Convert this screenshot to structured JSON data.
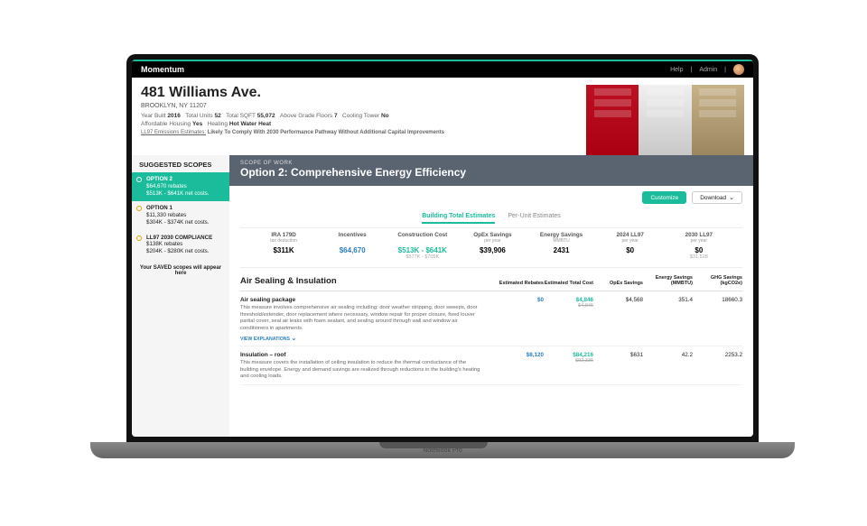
{
  "brand": "Momentum",
  "nav": {
    "help": "Help",
    "admin": "Admin"
  },
  "laptop": "NoteBook Pro",
  "property": {
    "name": "481 Williams Ave.",
    "addr2": "BROOKLYN, NY 11207",
    "meta": {
      "year_built_lbl": "Year Built",
      "year_built": "2016",
      "total_units_lbl": "Total Units",
      "total_units": "52",
      "total_sqft_lbl": "Total SQFT",
      "total_sqft": "55,072",
      "floors_lbl": "Above Grade Floors",
      "floors": "7",
      "cooling_lbl": "Cooling Tower",
      "cooling": "No",
      "afford_lbl": "Affordable Housing",
      "afford": "Yes",
      "heating_lbl": "Heating",
      "heating": "Hot Water Heat"
    },
    "estimates_lbl": "LL97 Emissions Estimates:",
    "estimates_val": "Likely To Comply With 2030 Performance Pathway Without Additional Capital Improvements"
  },
  "sidebar": {
    "title": "SUGGESTED SCOPES",
    "saved": "Your SAVED scopes will appear here",
    "items": [
      {
        "title": "OPTION 2",
        "l1": "$64,670 rebates",
        "l2": "$513K - $641K net costs."
      },
      {
        "title": "OPTION 1",
        "l1": "$11,330 rebates",
        "l2": "$304K - $374K net costs."
      },
      {
        "title": "LL97 2030 COMPLIANCE",
        "l1": "$138K rebates",
        "l2": "$204K - $280K net costs."
      }
    ]
  },
  "sow": {
    "label": "SCOPE OF WORK",
    "title": "Option 2: Comprehensive Energy Efficiency",
    "customize": "Customize",
    "download": "Download"
  },
  "tabs": {
    "a": "Building Total Estimates",
    "b": "Per-Unit Estimates"
  },
  "metrics": [
    {
      "label": "IRA 179D",
      "sub": "tax deduction",
      "value": "$311K"
    },
    {
      "label": "Incentives",
      "sub": "",
      "value": "$64,670",
      "style": "link"
    },
    {
      "label": "Construction Cost",
      "sub": "",
      "value": "$513K - $641K",
      "v2": "$577K - $705K",
      "style": "green"
    },
    {
      "label": "OpEx Savings",
      "sub": "per year",
      "value": "$39,906"
    },
    {
      "label": "Energy Savings",
      "sub": "MMBTU",
      "value": "2431"
    },
    {
      "label": "2024 LL97",
      "sub": "per year",
      "value": "$0"
    },
    {
      "label": "2030 LL97",
      "sub": "per year",
      "value": "$0",
      "v2": "$31,528"
    }
  ],
  "section": {
    "title": "Air Sealing & Insulation",
    "cols": [
      "Estimated Rebates",
      "Estimated Total Cost",
      "OpEx Savings",
      "Energy Savings (MMBTU)",
      "GHG Savings (kgCO2e)"
    ],
    "view_exp": "VIEW EXPLANATIONS",
    "rows": [
      {
        "title": "Air sealing package",
        "desc": "This measure involves comprehensive air sealing including: door weather stripping, door sweeps, door threshold/extender, door replacement where necessary, window repair for proper closure, fixed louver partial cover, seal air leaks with foam sealant, and sealing around through wall and window air conditioners in apartments.",
        "rebates": "$0",
        "cost": "$4,846",
        "cost_strike": "$4,846",
        "opex": "$4,568",
        "energy": "351.4",
        "ghg": "18660.3"
      },
      {
        "title": "Insulation – roof",
        "desc": "This measure covers the installation of ceiling insulation to reduce the thermal conductance of the building envelope. Energy and demand savings are realized through reductions in the building's heating and cooling loads.",
        "rebates": "$8,120",
        "cost": "$84,216",
        "cost_strike": "$92,336",
        "opex": "$631",
        "energy": "42.2",
        "ghg": "2253.2"
      }
    ]
  }
}
